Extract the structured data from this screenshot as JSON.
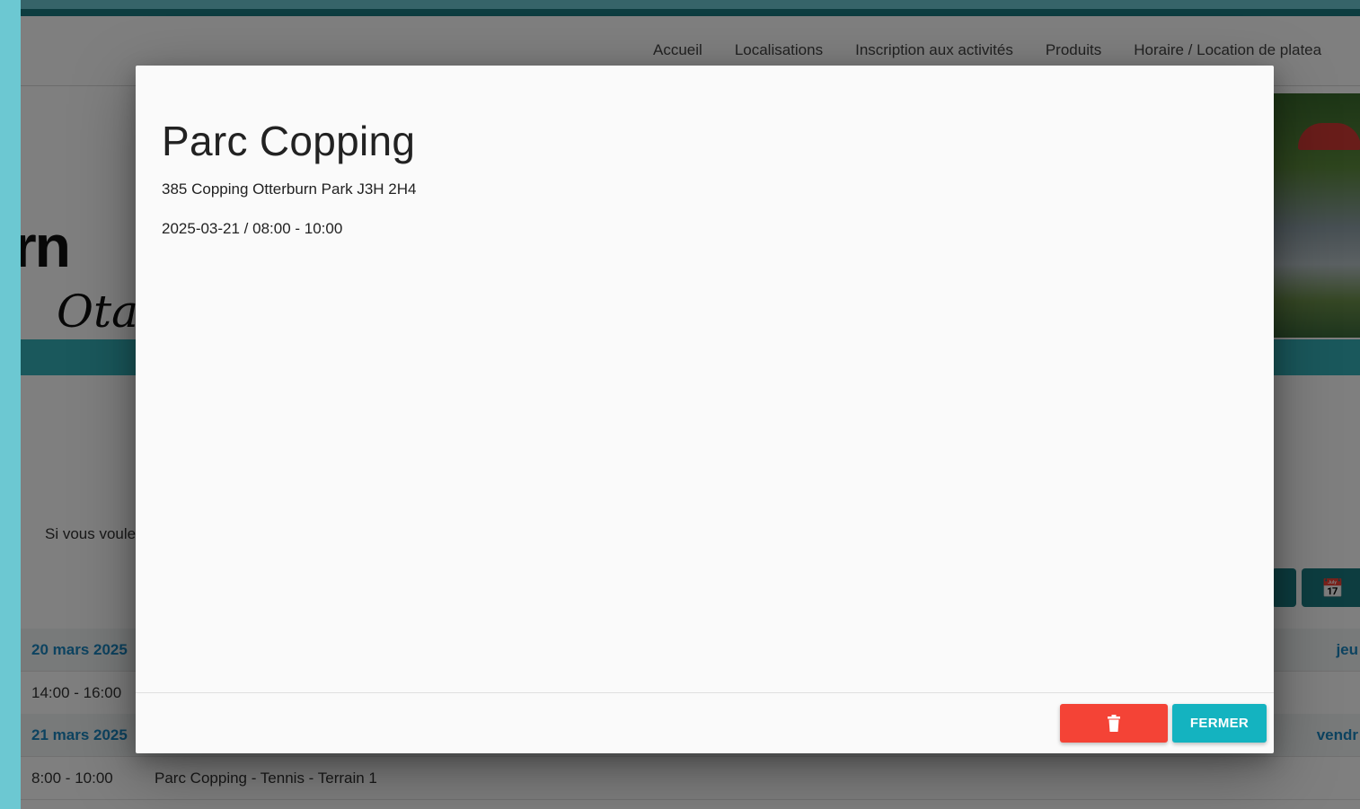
{
  "nav": {
    "items": [
      "Accueil",
      "Localisations",
      "Inscription aux activités",
      "Produits",
      "Horaire / Location de platea"
    ]
  },
  "banner": {
    "logo_fragment": "rn",
    "script_fragment": "Ota"
  },
  "intro": {
    "text": "Si vous voule"
  },
  "schedule": {
    "rows": [
      {
        "date": "20 mars 2025",
        "day": "jeu"
      },
      {
        "time": "14:00 - 16:00"
      },
      {
        "date": "21 mars 2025",
        "day": "vendr"
      },
      {
        "time": "8:00 - 10:00",
        "event": "Parc Copping - Tennis - Terrain 1"
      }
    ]
  },
  "modal": {
    "title": "Parc Copping",
    "address": "385 Copping Otterburn Park J3H 2H4",
    "when": "2025-03-21 / 08:00 - 10:00",
    "delete_icon": "trash-icon",
    "close_label": "FERMER"
  },
  "colors": {
    "accent": "#14b3c0",
    "danger": "#f44336",
    "brand_dark": "#1b7a80",
    "date_link": "#1a86c0"
  }
}
